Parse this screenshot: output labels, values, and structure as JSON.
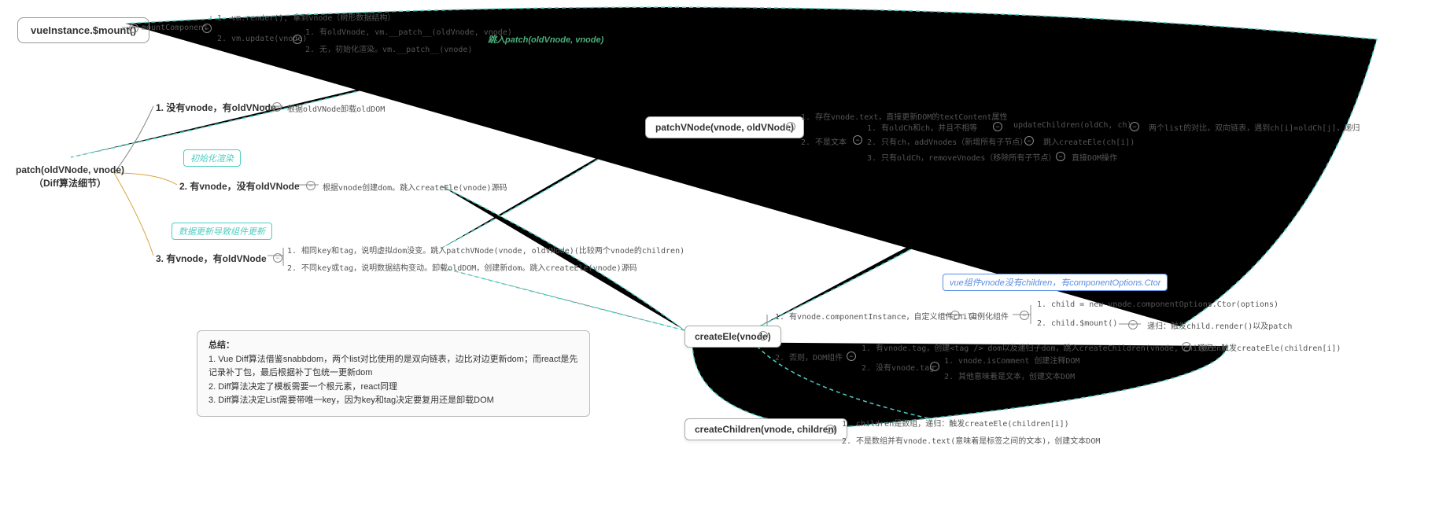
{
  "root": {
    "title": "vueInstance.$mount()"
  },
  "mount": {
    "component": "mountComponent",
    "step1": "1. vm.render(), 拿到vnode（树形数据结构）",
    "step2": "2. vm.update(vnode)",
    "sub1": "1. 有oldVnode, vm.__patch__(oldVnode, vnode)",
    "sub2": "2. 无，初始化渲染。vm.__patch__(vnode)",
    "callout": "跳入patch(oldVnode, vnode)"
  },
  "patch": {
    "title": "patch(oldVNode, vnode)\n（Diff算法细节）",
    "b1": {
      "label": "1. 没有vnode，有oldVNode",
      "detail": "根据oldVNode卸载oldDOM"
    },
    "b2": {
      "tag": "初始化渲染",
      "label": "2. 有vnode，没有oldVNode",
      "detail": "根据vnode创建dom。跳入createEle(vnode)源码"
    },
    "b3": {
      "tag": "数据更新导致组件更新",
      "label": "3. 有vnode，有oldVNode",
      "s1": "1. 相同key和tag，说明虚拟dom没变。跳入patchVNode(vnode, oldVNode)(比较两个vnode的children)",
      "s2": "2. 不同key或tag，说明数据结构变动。卸载oldDOM，创建新dom。跳入createEle(vnode)源码"
    }
  },
  "patchVNode": {
    "title": "patchVNode(vnode, oldVNode)",
    "a1": "1. 存在vnode.text，直接更新DOM的textContent属性",
    "a2": "2. 不是文本",
    "c1": "1. 有oldCh和ch，并且不相等",
    "c1d": "updateChildren(oldCh, ch)",
    "c1e": "两个list的对比，双向链表，遇到ch[i]=oldCh[j]，递归",
    "c2": "2. 只有ch，addVnodes（新增所有子节点）",
    "c2d": "跳入createEle(ch[i])",
    "c3": "3. 只有oldCh，removeVnodes（移除所有子节点）",
    "c3d": "直接DOM操作"
  },
  "createEle": {
    "title": "createEle(vnode)",
    "tag": "vue组件vnode没有children，有componentOptions.Ctor",
    "a1": "1. 有vnode.componentInstance，自定义组件child",
    "a1d": "实例化组件",
    "a1s1": "1. child = new vnode.componentOptions.Ctor(options)",
    "a1s2": "2. child.$mount()",
    "a1s2d": "递归：触发child.render()以及patch",
    "a2": "2. 否则，DOM组件",
    "a2s1": "1. 有vnode.tag，创建<tag /> dom以及递归子dom，跳入createChildren(vnode, children)",
    "a2s1d": "递归：触发createEle(children[i])",
    "a2s2": "2. 没有vnode.tag",
    "a2s2a": "1. vnode.isComment 创建注释DOM",
    "a2s2b": "2. 其他意味着是文本，创建文本DOM"
  },
  "createChildren": {
    "title": "createChildren(vnode, children)",
    "a1": "1. children是数组，递归：触发createEle(children[i])",
    "a2": "2. 不是数组并有vnode.text(意味着是标签之间的文本)，创建文本DOM"
  },
  "summary": {
    "title": "总结：",
    "l1": "1. Vue Diff算法借鉴snabbdom，两个list对比使用的是双向链表，边比对边更新dom；而react是先记录补丁包，最后根据补丁包统一更新dom",
    "l2": "2. Diff算法决定了模板需要一个根元素，react同理",
    "l3": "3. Diff算法决定List需要带唯一key，因为key和tag决定要复用还是卸载DOM"
  }
}
